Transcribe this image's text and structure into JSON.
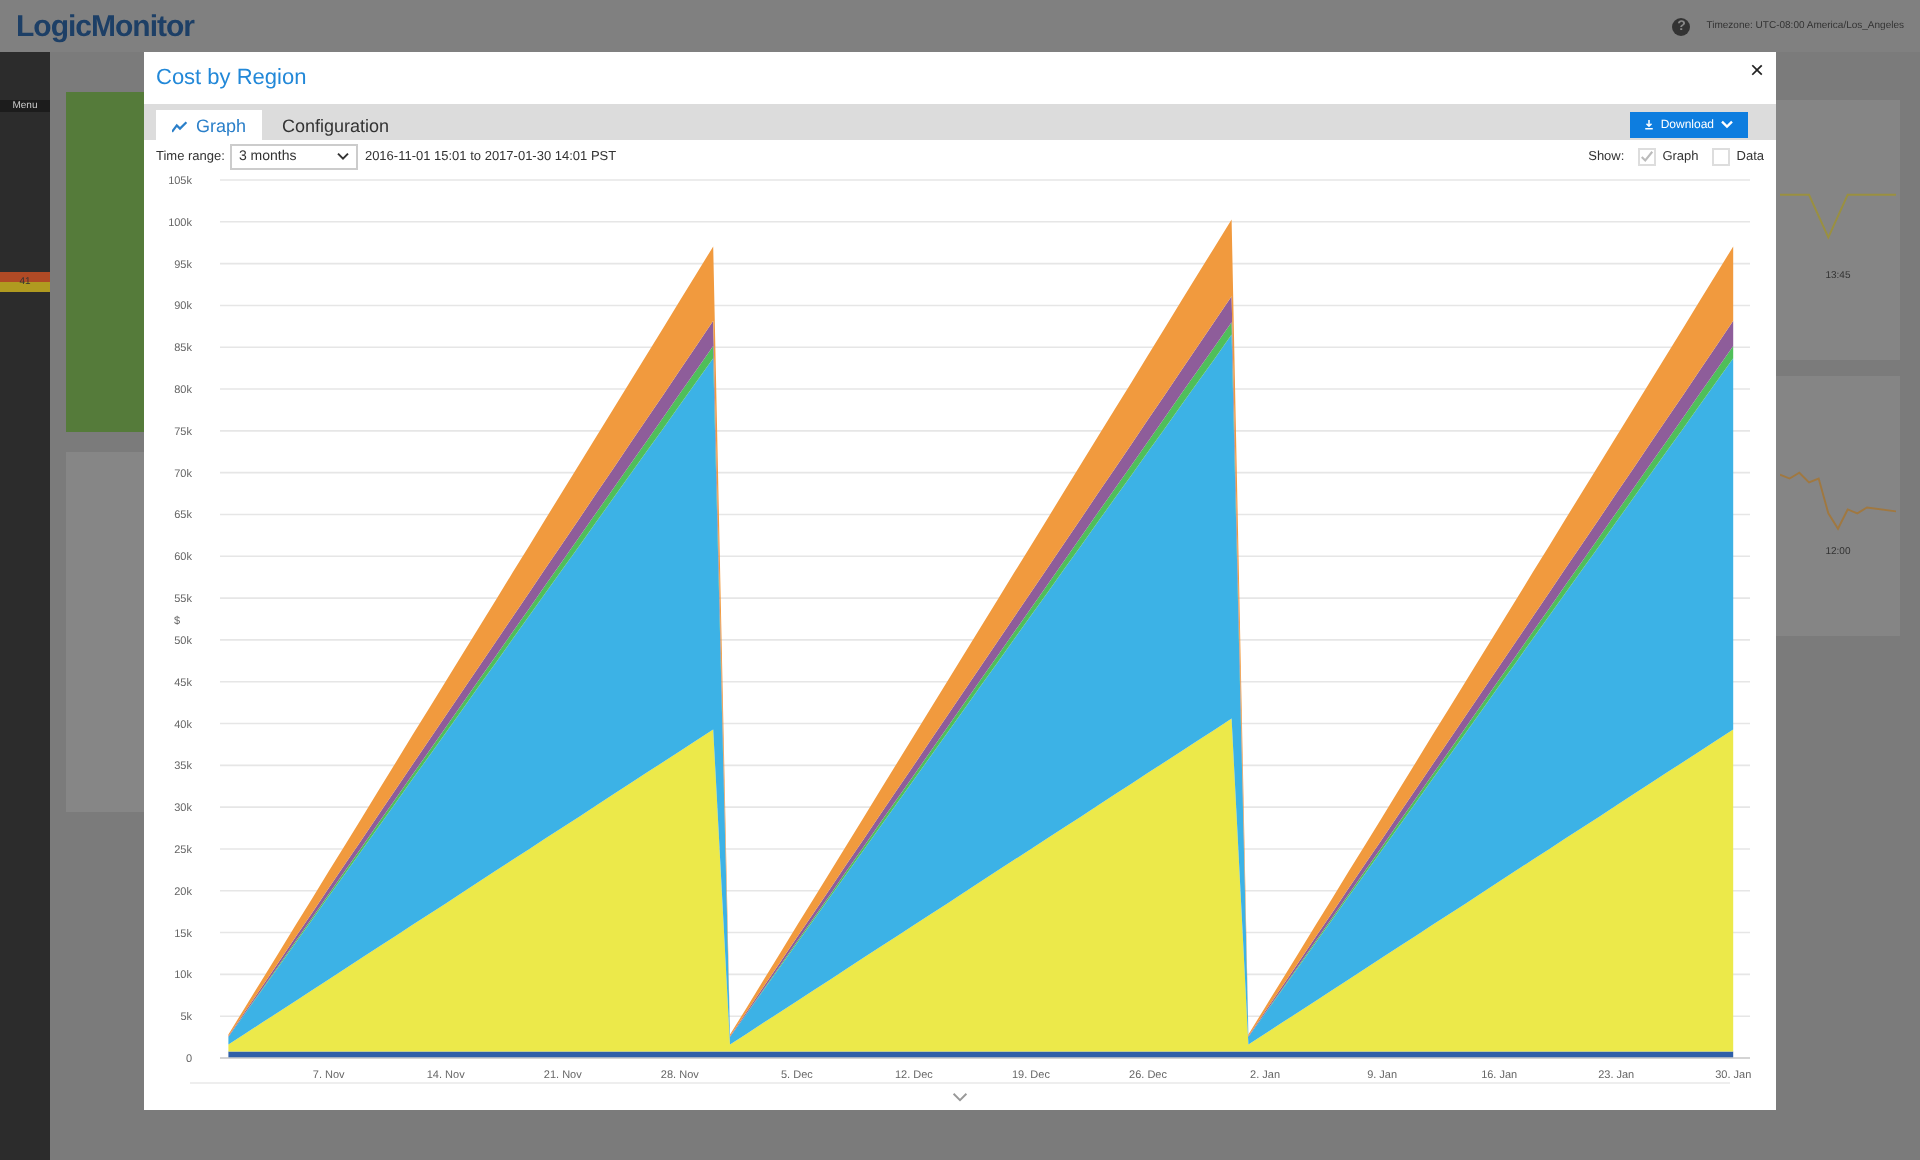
{
  "top_bar": {
    "logo": "LogicMonitor",
    "help": "?",
    "timezone": "Timezone: UTC-08:00 America/Los_Angeles"
  },
  "sidebar": {
    "menu_label": "Menu",
    "alert_count": "41"
  },
  "background_panels": [
    {
      "time_label": "13:45"
    },
    {
      "time_label": "12:00"
    }
  ],
  "dialog": {
    "title": "Cost by Region",
    "close": "×",
    "tabs": [
      {
        "label": "Graph",
        "selected": true
      },
      {
        "label": "Configuration",
        "selected": false
      }
    ],
    "download_label": "Download",
    "time_range": {
      "label": "Time range:",
      "value": "3 months",
      "span": "2016-11-01 15:01 to 2017-01-30 14:01 PST"
    },
    "show": {
      "label": "Show:",
      "options": [
        {
          "label": "Graph",
          "checked": true
        },
        {
          "label": "Data",
          "checked": false
        }
      ]
    },
    "chart_data": {
      "type": "area",
      "stacked": true,
      "ylabel": "$",
      "grid": true,
      "ylim": [
        0,
        105000
      ],
      "categories": [
        null,
        null,
        null,
        null,
        null,
        null,
        "7. Nov",
        null,
        null,
        null,
        null,
        null,
        null,
        "14. Nov",
        null,
        null,
        null,
        null,
        null,
        null,
        "21. Nov",
        null,
        null,
        null,
        null,
        null,
        null,
        "28. Nov",
        null,
        null,
        null,
        null,
        null,
        null,
        "5. Dec",
        null,
        null,
        null,
        null,
        null,
        null,
        "12. Dec",
        null,
        null,
        null,
        null,
        null,
        null,
        "19. Dec",
        null,
        null,
        null,
        null,
        null,
        null,
        "26. Dec",
        null,
        null,
        null,
        null,
        null,
        null,
        "2. Jan",
        null,
        null,
        null,
        null,
        null,
        null,
        "9. Jan",
        null,
        null,
        null,
        null,
        null,
        null,
        "16. Jan",
        null,
        null,
        null,
        null,
        null,
        null,
        "23. Jan",
        null,
        null,
        null,
        null,
        null,
        null,
        "30. Jan"
      ],
      "yticks": [
        0,
        {
          "value": 5000,
          "label": "5k"
        },
        {
          "value": 10000,
          "label": "10k"
        },
        {
          "value": 15000,
          "label": "15k"
        },
        {
          "value": 20000,
          "label": "20k"
        },
        {
          "value": 25000,
          "label": "25k"
        },
        {
          "value": 30000,
          "label": "30k"
        },
        {
          "value": 35000,
          "label": "35k"
        },
        {
          "value": 40000,
          "label": "40k"
        },
        {
          "value": 45000,
          "label": "45k"
        },
        {
          "value": 50000,
          "label": "50k"
        },
        {
          "value": 55000,
          "label": "55k"
        },
        {
          "value": 60000,
          "label": "60k"
        },
        {
          "value": 65000,
          "label": "65k"
        },
        {
          "value": 70000,
          "label": "70k"
        },
        {
          "value": 75000,
          "label": "75k"
        },
        {
          "value": 80000,
          "label": "80k"
        },
        {
          "value": 85000,
          "label": "85k"
        },
        {
          "value": 90000,
          "label": "90k"
        },
        {
          "value": 95000,
          "label": "95k"
        },
        {
          "value": 100000,
          "label": "100k"
        },
        {
          "value": 105000,
          "label": "105k"
        }
      ],
      "series": [
        {
          "color": "#2f5fa8",
          "values": [
            800,
            800,
            800,
            800,
            800,
            800,
            800,
            800,
            800,
            800,
            800,
            800,
            800,
            800,
            800,
            800,
            800,
            800,
            800,
            800,
            800,
            800,
            800,
            800,
            800,
            800,
            800,
            800,
            800,
            800,
            800,
            800,
            800,
            800,
            800,
            800,
            800,
            800,
            800,
            800,
            800,
            800,
            800,
            800,
            800,
            800,
            800,
            800,
            800,
            800,
            800,
            800,
            800,
            800,
            800,
            800,
            800,
            800,
            800,
            800,
            800,
            800,
            800,
            800,
            800,
            800,
            800,
            800,
            800,
            800,
            800,
            800,
            800,
            800,
            800,
            800,
            800,
            800,
            800,
            800,
            800,
            800,
            800,
            800,
            800,
            800,
            800,
            800,
            800,
            800,
            800
          ]
        },
        {
          "color": "#ece94a",
          "values": [
            800,
            2100,
            3400,
            4700,
            6000,
            7300,
            8600,
            9900,
            11200,
            12500,
            13800,
            15100,
            16400,
            17700,
            19000,
            20300,
            21600,
            22900,
            24200,
            25500,
            26800,
            28100,
            29400,
            30700,
            32000,
            33300,
            34600,
            35900,
            37200,
            38500,
            800,
            2100,
            3400,
            4700,
            6000,
            7300,
            8600,
            9900,
            11200,
            12500,
            13800,
            15100,
            16400,
            17700,
            19000,
            20300,
            21600,
            22900,
            24200,
            25500,
            26800,
            28100,
            29400,
            30700,
            32000,
            33300,
            34600,
            35900,
            37200,
            38500,
            39800,
            800,
            2100,
            3400,
            4700,
            6000,
            7300,
            8600,
            9900,
            11200,
            12500,
            13800,
            15100,
            16400,
            17700,
            19000,
            20300,
            21600,
            22900,
            24200,
            25500,
            26800,
            28100,
            29400,
            30700,
            32000,
            33300,
            34600,
            35900,
            37200,
            38500
          ]
        },
        {
          "color": "#3cb2e6",
          "values": [
            900,
            2400,
            3900,
            5400,
            6900,
            8400,
            9900,
            11400,
            12900,
            14400,
            15900,
            17400,
            18900,
            20400,
            21900,
            23400,
            24900,
            26400,
            27900,
            29400,
            30900,
            32400,
            33900,
            35400,
            36900,
            38400,
            39900,
            41400,
            42900,
            44400,
            900,
            2400,
            3900,
            5400,
            6900,
            8400,
            9900,
            11400,
            12900,
            14400,
            15900,
            17400,
            18900,
            20400,
            21900,
            23400,
            24900,
            26400,
            27900,
            29400,
            30900,
            32400,
            33900,
            35400,
            36900,
            38400,
            39900,
            41400,
            42900,
            44400,
            45900,
            900,
            2400,
            3900,
            5400,
            6900,
            8400,
            9900,
            11400,
            12900,
            14400,
            15900,
            17400,
            18900,
            20400,
            21900,
            23400,
            24900,
            26400,
            27900,
            29400,
            30900,
            32400,
            33900,
            35400,
            36900,
            38400,
            39900,
            41400,
            42900,
            44400
          ]
        },
        {
          "color": "#4fbf5a",
          "values": [
            0,
            50,
            100,
            150,
            200,
            250,
            300,
            350,
            400,
            450,
            500,
            550,
            600,
            650,
            700,
            750,
            800,
            850,
            900,
            950,
            1000,
            1050,
            1100,
            1150,
            1200,
            1250,
            1300,
            1350,
            1400,
            1450,
            0,
            50,
            100,
            150,
            200,
            250,
            300,
            350,
            400,
            450,
            500,
            550,
            600,
            650,
            700,
            750,
            800,
            850,
            900,
            950,
            1000,
            1050,
            1100,
            1150,
            1200,
            1250,
            1300,
            1350,
            1400,
            1450,
            1500,
            0,
            50,
            100,
            150,
            200,
            250,
            300,
            350,
            400,
            450,
            500,
            550,
            600,
            650,
            700,
            750,
            800,
            850,
            900,
            950,
            1000,
            1050,
            1100,
            1150,
            1200,
            1250,
            1300,
            1350,
            1400,
            1450
          ]
        },
        {
          "color": "#8e5d9a",
          "values": [
            100,
            200,
            300,
            400,
            500,
            600,
            700,
            800,
            900,
            1000,
            1100,
            1200,
            1300,
            1400,
            1500,
            1600,
            1700,
            1800,
            1900,
            2000,
            2100,
            2200,
            2300,
            2400,
            2500,
            2600,
            2700,
            2800,
            2900,
            3000,
            100,
            200,
            300,
            400,
            500,
            600,
            700,
            800,
            900,
            1000,
            1100,
            1200,
            1300,
            1400,
            1500,
            1600,
            1700,
            1800,
            1900,
            2000,
            2100,
            2200,
            2300,
            2400,
            2500,
            2600,
            2700,
            2800,
            2900,
            3000,
            3100,
            100,
            200,
            300,
            400,
            500,
            600,
            700,
            800,
            900,
            1000,
            1100,
            1200,
            1300,
            1400,
            1500,
            1600,
            1700,
            1800,
            1900,
            2000,
            2100,
            2200,
            2300,
            2400,
            2500,
            2600,
            2700,
            2800,
            2900,
            3000
          ]
        },
        {
          "color": "#f19a3e",
          "values": [
            200,
            500,
            800,
            1100,
            1400,
            1700,
            2000,
            2300,
            2600,
            2900,
            3200,
            3500,
            3800,
            4100,
            4400,
            4700,
            5000,
            5300,
            5600,
            5900,
            6200,
            6500,
            6800,
            7100,
            7400,
            7700,
            8000,
            8300,
            8600,
            8900,
            200,
            500,
            800,
            1100,
            1400,
            1700,
            2000,
            2300,
            2600,
            2900,
            3200,
            3500,
            3800,
            4100,
            4400,
            4700,
            5000,
            5300,
            5600,
            5900,
            6200,
            6500,
            6800,
            7100,
            7400,
            7700,
            8000,
            8300,
            8600,
            8900,
            9200,
            200,
            500,
            800,
            1100,
            1400,
            1700,
            2000,
            2300,
            2600,
            2900,
            3200,
            3500,
            3800,
            4100,
            4400,
            4700,
            5000,
            5300,
            5600,
            5900,
            6200,
            6500,
            6800,
            7100,
            7400,
            7700,
            8000,
            8300,
            8600,
            8900
          ]
        }
      ]
    }
  }
}
